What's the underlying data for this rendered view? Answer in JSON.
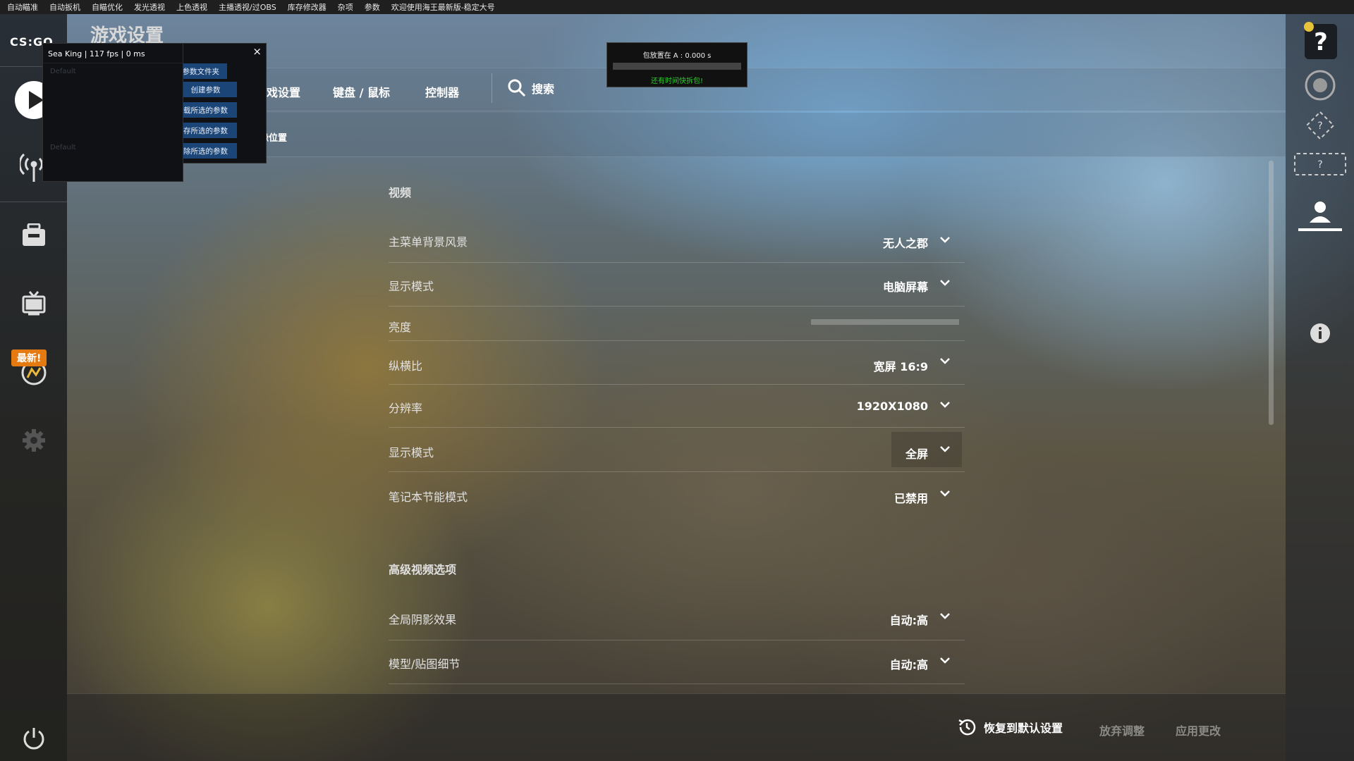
{
  "menu": [
    "自动瞄准",
    "自动扳机",
    "自瞄优化",
    "发光透视",
    "上色透视",
    "主播透视/过OBS",
    "库存修改器",
    "杂项",
    "参数",
    "欢迎使用海王最新版-稳定大号"
  ],
  "sidebar": {
    "logo": "CS:GO",
    "new_badge": "最新!",
    "icons": [
      "play-icon",
      "broadcast-icon",
      "inventory-icon",
      "watch-icon",
      "news-icon",
      "settings-icon",
      "power-icon"
    ]
  },
  "page_title": "游戏设置",
  "tabs": [
    "游戏设置",
    "键盘 / 鼠标",
    "控制器"
  ],
  "search_label": "搜索",
  "subtab": "缘位置",
  "bomb": {
    "title": "包放置在 A : 0.000 s",
    "status": "还有时间快拆包!"
  },
  "overlay": {
    "title": "Sea King | 117 fps | 0 ms",
    "ghost": [
      "Default",
      "Default"
    ],
    "buttons": [
      "开参数文件夹",
      "创建参数",
      "载所选的参数",
      "存所选的参数",
      "除所选的参数"
    ],
    "close": "×"
  },
  "video": {
    "section": "视频",
    "rows": [
      {
        "label": "主菜单背景风景",
        "value": "无人之郡"
      },
      {
        "label": "显示模式",
        "value": "电脑屏幕"
      },
      {
        "label": "亮度",
        "value": ""
      },
      {
        "label": "纵横比",
        "value": "宽屏 16:9"
      },
      {
        "label": "分辨率",
        "value": "1920X1080"
      },
      {
        "label": "显示模式",
        "value": "全屏"
      },
      {
        "label": "笔记本节能模式",
        "value": "已禁用"
      }
    ]
  },
  "advanced": {
    "section": "高级视频选项",
    "rows": [
      {
        "label": "全局阴影效果",
        "value": "自动:高"
      },
      {
        "label": "模型/贴图细节",
        "value": "自动:高"
      }
    ]
  },
  "bottom": {
    "reset": "恢复到默认设置",
    "discard": "放弃调整",
    "apply": "应用更改"
  },
  "right_icons": [
    "help-icon",
    "rank-icon",
    "unknown-rank-icon",
    "unknown-rank-box-icon",
    "user-icon",
    "info-icon"
  ]
}
